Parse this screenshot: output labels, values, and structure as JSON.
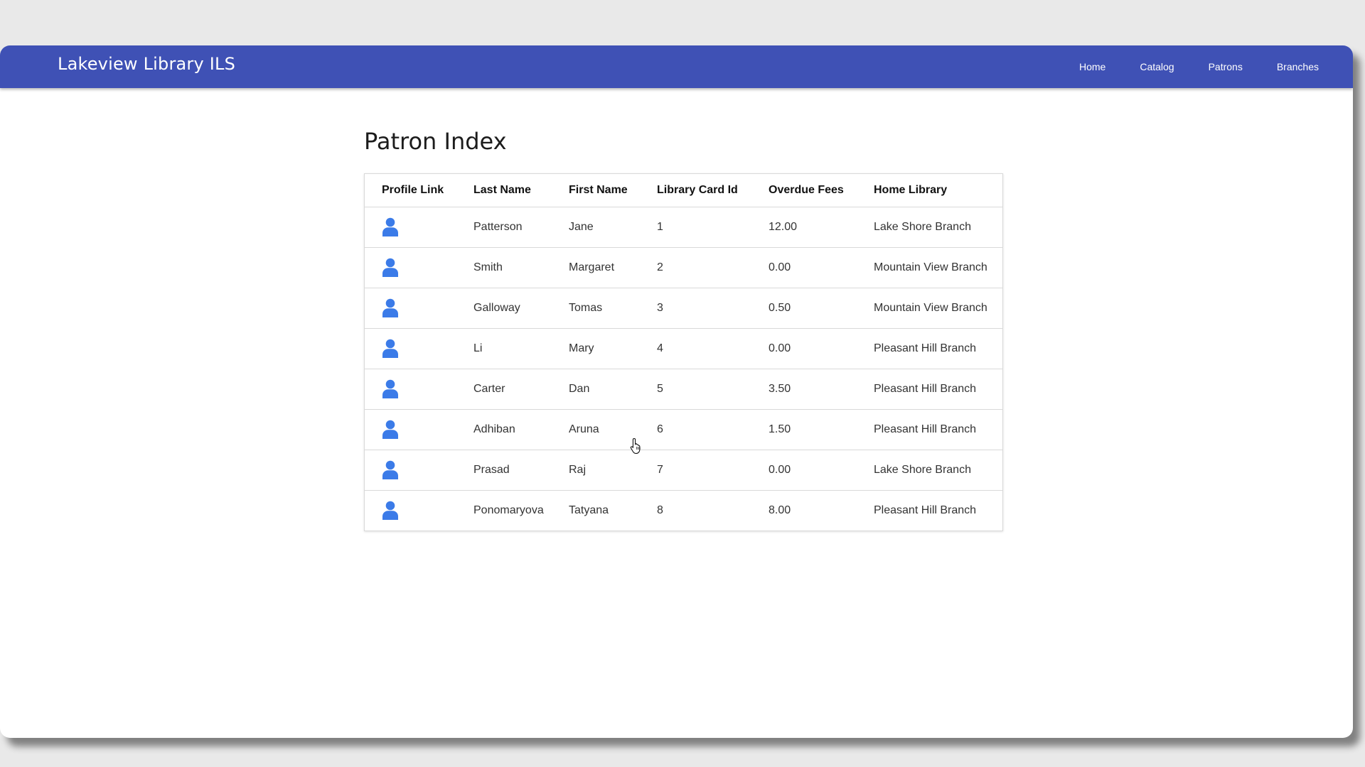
{
  "app": {
    "brand": "Lakeview Library ILS"
  },
  "nav": {
    "items": [
      {
        "label": "Home"
      },
      {
        "label": "Catalog"
      },
      {
        "label": "Patrons"
      },
      {
        "label": "Branches"
      }
    ]
  },
  "page": {
    "title": "Patron Index"
  },
  "table": {
    "headers": {
      "profile": "Profile Link",
      "last": "Last Name",
      "first": "First Name",
      "card": "Library Card Id",
      "fees": "Overdue Fees",
      "home": "Home Library"
    },
    "rows": [
      {
        "last": "Patterson",
        "first": "Jane",
        "card": "1",
        "fees": "12.00",
        "home": "Lake Shore Branch"
      },
      {
        "last": "Smith",
        "first": "Margaret",
        "card": "2",
        "fees": "0.00",
        "home": "Mountain View Branch"
      },
      {
        "last": "Galloway",
        "first": "Tomas",
        "card": "3",
        "fees": "0.50",
        "home": "Mountain View Branch"
      },
      {
        "last": "Li",
        "first": "Mary",
        "card": "4",
        "fees": "0.00",
        "home": "Pleasant Hill Branch"
      },
      {
        "last": "Carter",
        "first": "Dan",
        "card": "5",
        "fees": "3.50",
        "home": "Pleasant Hill Branch"
      },
      {
        "last": "Adhiban",
        "first": "Aruna",
        "card": "6",
        "fees": "1.50",
        "home": "Pleasant Hill Branch"
      },
      {
        "last": "Prasad",
        "first": "Raj",
        "card": "7",
        "fees": "0.00",
        "home": "Lake Shore Branch"
      },
      {
        "last": "Ponomaryova",
        "first": "Tatyana",
        "card": "8",
        "fees": "8.00",
        "home": "Pleasant Hill Branch"
      }
    ]
  },
  "icons": {
    "profile": "user-icon",
    "cursor": "hand-pointer-icon"
  },
  "colors": {
    "navbar": "#3f51b5",
    "icon": "#3b7be8"
  }
}
